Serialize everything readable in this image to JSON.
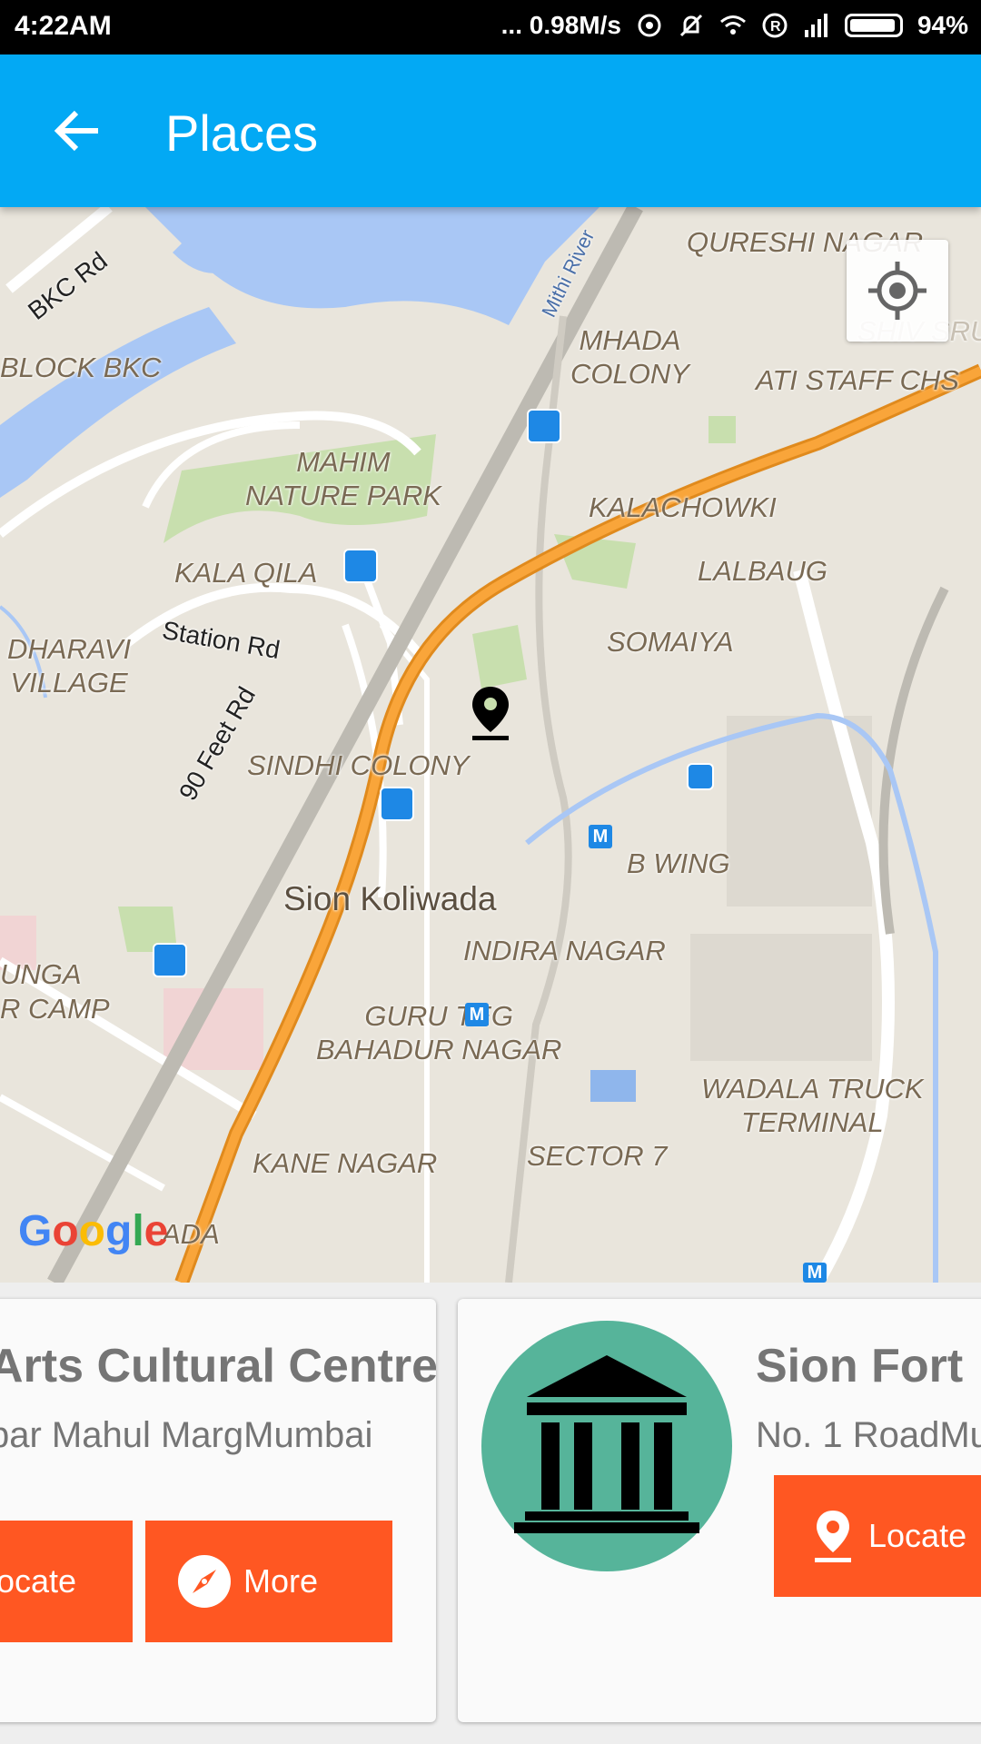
{
  "status_bar": {
    "time": "4:22AM",
    "speed": "... 0.98M/s",
    "battery": "94%"
  },
  "app_bar": {
    "back_icon": "arrow-left-icon",
    "title": "Places"
  },
  "map": {
    "labels": {
      "qureshi_nagar": "QURESHI NAGAR",
      "shiv_sru": "SHIV SRU",
      "bkc_rd": "BKC Rd",
      "block_bkc": "BLOCK BKC",
      "mithi_river": "Mithi River",
      "mhada_colony_1": "MHADA",
      "mhada_colony_2": "COLONY",
      "ati_staff": "ATI STAFF CHS",
      "mahim_1": "MAHIM",
      "mahim_2": "NATURE PARK",
      "kalachowki": "KALACHOWKI",
      "lalbaug": "LALBAUG",
      "kala_qila": "KALA QILA",
      "station_rd": "Station Rd",
      "dharavi_1": "DHARAVI",
      "dharavi_2": "VILLAGE",
      "somaiya": "SOMAIYA",
      "ninety_feet": "90 Feet Rd",
      "sindhi_colony": "SINDHI COLONY",
      "b_wing": "B WING",
      "sion_koliwada": "Sion Koliwada",
      "indira_nagar": "INDIRA NAGAR",
      "unga": "UNGA",
      "r_camp": "R CAMP",
      "guru_1": "GURU TEG",
      "guru_2": "BAHADUR NAGAR",
      "wadala_1": "WADALA TRUCK",
      "wadala_2": "TERMINAL",
      "kane_nagar": "KANE NAGAR",
      "sector_7": "SECTOR 7",
      "ada": "ADA",
      "metro": "M"
    },
    "google": "Google",
    "my_location_icon": "crosshair-icon",
    "marker_icon": "map-pin-icon"
  },
  "cards": [
    {
      "title": "Arts Cultural Centre",
      "address": "bar Mahul MargMumbai",
      "locate_label": "ocate",
      "more_label": "More",
      "more_icon": "compass-icon"
    },
    {
      "title": "Sion Fort",
      "address": "No. 1 RoadMu",
      "locate_label": "Locate",
      "locate_icon": "map-pin-icon",
      "image_icon": "monument-icon"
    }
  ],
  "colors": {
    "app_bar": "#03a9f4",
    "button": "#ff5722",
    "avatar": "#56b49a",
    "highway": "#f79d2a",
    "water": "#a9c7f5",
    "park": "#c8dfae"
  }
}
